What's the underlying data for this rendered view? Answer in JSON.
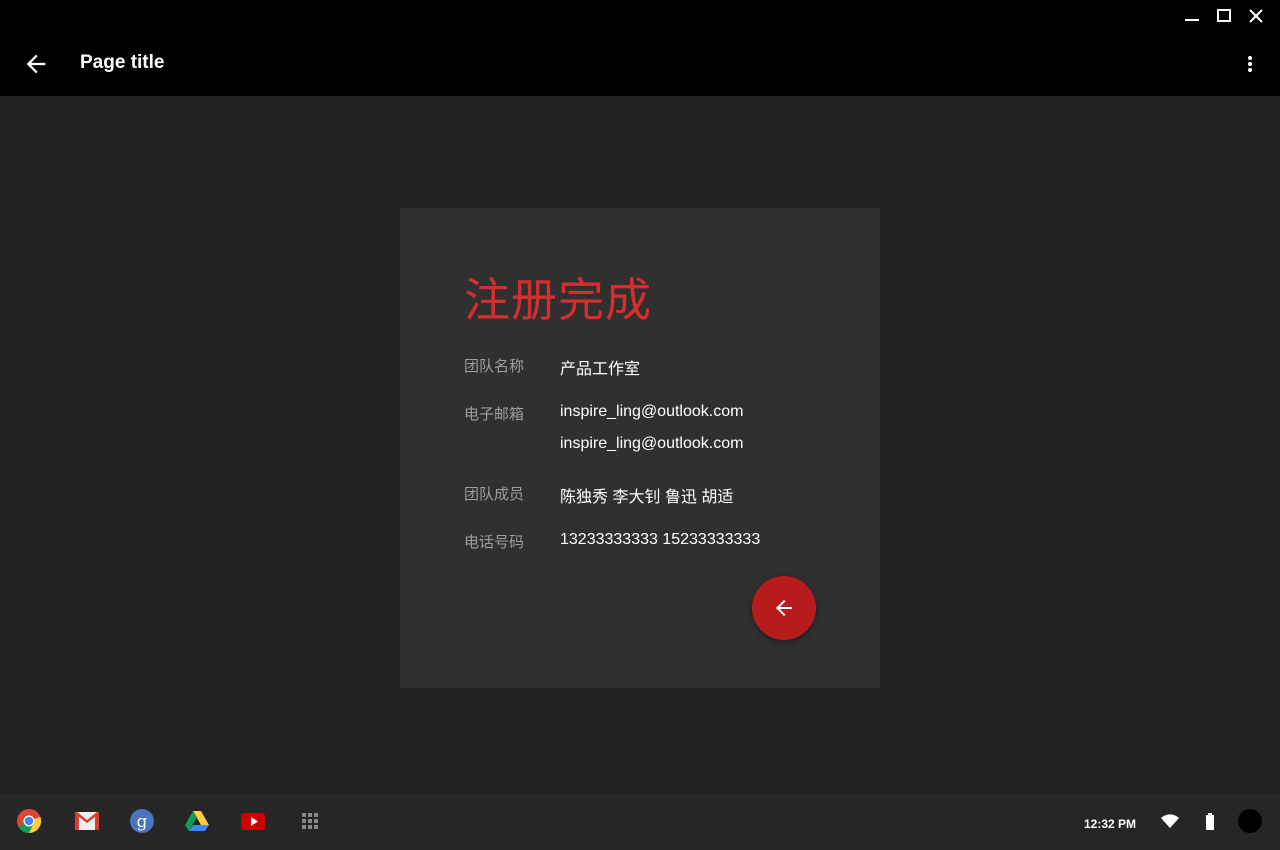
{
  "header": {
    "title": "Page title"
  },
  "card": {
    "heading": "注册完成",
    "fields": [
      {
        "label": "团队名称",
        "values": [
          "产品工作室"
        ]
      },
      {
        "label": "电子邮箱",
        "values": [
          "inspire_ling@outlook.com",
          "inspire_ling@outlook.com"
        ]
      },
      {
        "label": "团队成员",
        "values": [
          "陈独秀 李大钊 鲁迅 胡适"
        ]
      },
      {
        "label": "电话号码",
        "values": [
          "13233333333 15233333333"
        ]
      }
    ],
    "accent": "#d32f2f"
  },
  "shelf": {
    "apps": [
      "chrome-icon",
      "gmail-icon",
      "google-search-icon",
      "drive-icon",
      "youtube-icon",
      "app-launcher-icon"
    ],
    "time": "12:32 PM"
  }
}
